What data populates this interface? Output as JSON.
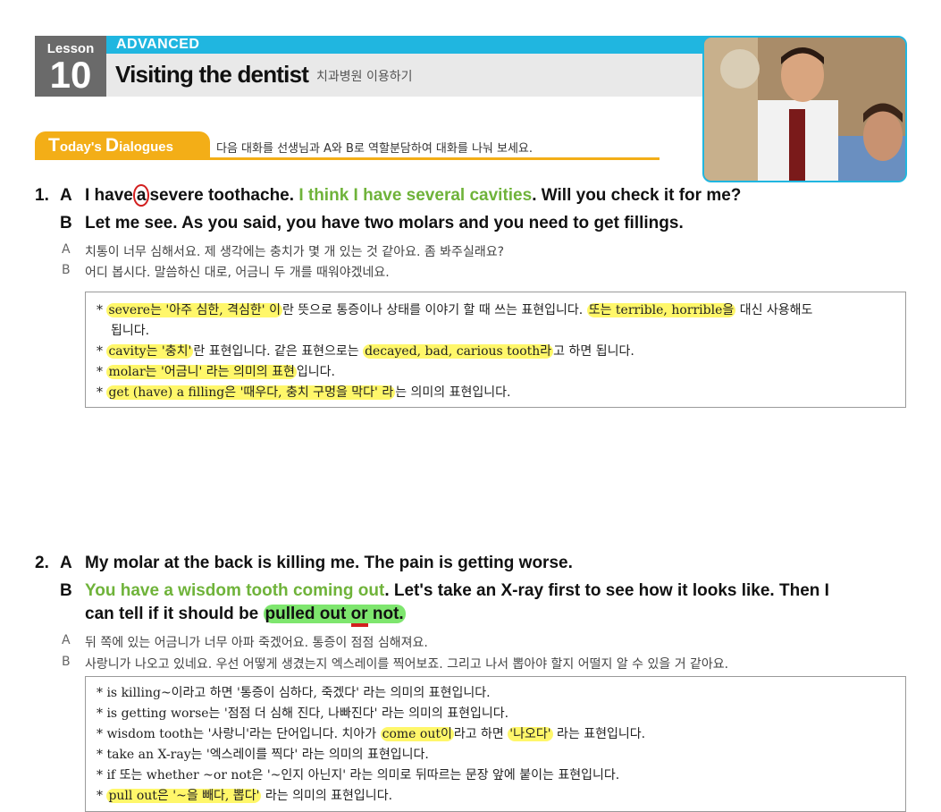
{
  "header": {
    "lesson_label": "Lesson",
    "lesson_number": "10",
    "level": "ADVANCED",
    "title_en": "Visiting the dentist",
    "title_ko": "치과병원 이용하기"
  },
  "todays": {
    "t": "T",
    "oday": "oday's ",
    "d": "D",
    "ialogues": "ialogues",
    "instruction": "다음 대화를 선생님과 A와 B로 역할분담하여 대화를 나눠 보세요."
  },
  "d1": {
    "number": "1.",
    "a_speaker": "A",
    "a_1": "I have",
    "a_circled": "a",
    "a_2": "severe toothache.",
    "a_green": "I think I have several cavities",
    "a_3": ". Will you check it for me?",
    "b_speaker": "B",
    "b_line": "Let me see. As you said, you have two molars and you need to get fillings.",
    "ko_a_speaker": "A",
    "ko_a": "치통이 너무 심해서요. 제 생각에는 충치가 몇 개 있는 것 같아요. 좀 봐주실래요?",
    "ko_b_speaker": "B",
    "ko_b": "어디 봅시다. 말씀하신 대로, 어금니 두 개를 때워야겠네요.",
    "notes": {
      "n1_star": "*",
      "n1_hl": "severe는 '아주 심한, 격심한' 이",
      "n1_mid": "란 뜻으로 통증이나 상태를 이야기 할 때 쓰는 표현입니다.",
      "n1_hl2": "또는 terrible, horrible을",
      "n1_end": " 대신 사용해도",
      "n1_cont": "됩니다.",
      "n2_star": "*",
      "n2_hl": "cavity는 '충치'",
      "n2_mid": "란 표현입니다. 같은 표현으로는 ",
      "n2_hl2": "decayed, bad, carious tooth라",
      "n2_end": "고 하면 됩니다.",
      "n3_star": "*",
      "n3_hl": "molar는 '어금니' 라는 의미의 표현",
      "n3_end": "입니다.",
      "n4_star": "*",
      "n4_hl": "get (have) a filling은 '때우다, 충치 구멍을 막다' 라",
      "n4_end": "는 의미의 표현입니다."
    }
  },
  "d2": {
    "number": "2.",
    "a_speaker": "A",
    "a_line": "My molar at the back is killing me. The pain is getting worse.",
    "b_speaker": "B",
    "b_green": "You have a wisdom tooth coming out",
    "b_1": ". Let's take an X-ray first to see how it looks like. Then I",
    "b_2": "can tell if it should be ",
    "b_hl_1": "pulled out ",
    "b_or": "or",
    "b_hl_2": " not.",
    "ko_a_speaker": "A",
    "ko_a": "뒤 쪽에 있는 어금니가 너무 아파 죽겠어요. 통증이 점점 심해져요.",
    "ko_b_speaker": "B",
    "ko_b": "사랑니가 나오고 있네요. 우선 어떻게 생겼는지 엑스레이를 찍어보죠. 그리고 나서 뽑아야 할지 어떨지 알 수 있을 거 같아요.",
    "notes": {
      "n1_star": "*",
      "n1": "is killing~이라고 하면 '통증이 심하다, 죽겠다' 라는 의미의 표현입니다.",
      "n2_star": "*",
      "n2": "is getting worse는 '점점 더 심해 진다, 나빠진다' 라는 의미의 표현입니다.",
      "n3_star": "*",
      "n3_a": "wisdom tooth는 '사랑니'라는 단어입니다. 치아가 ",
      "n3_hl": "come out이",
      "n3_b": "라고 하면 ",
      "n3_hl2": "'나오다'",
      "n3_c": " 라는 표현입니다.",
      "n4_star": "*",
      "n4": "take an X-ray는 '엑스레이를 찍다' 라는 의미의 표현입니다.",
      "n5_star": "*",
      "n5": "if 또는 whether ~or not은 '~인지 아닌지' 라는 의미로 뒤따르는 문장 앞에 붙이는 표현입니다.",
      "n6_star": "*",
      "n6_hl": "pull out은 '~을 빼다, 뽑다'",
      "n6_end": " 라는 의미의 표현입니다."
    }
  }
}
